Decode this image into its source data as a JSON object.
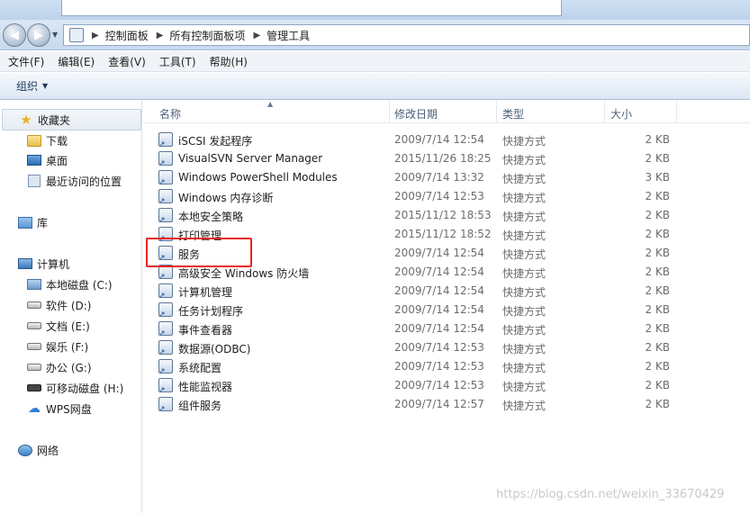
{
  "address": {
    "breadcrumbs": [
      "控制面板",
      "所有控制面板项",
      "管理工具"
    ]
  },
  "menu": [
    "文件(F)",
    "编辑(E)",
    "查看(V)",
    "工具(T)",
    "帮助(H)"
  ],
  "toolbar": {
    "organize": "组织"
  },
  "nav": {
    "favorites": "收藏夹",
    "downloads": "下载",
    "desktop": "桌面",
    "recent": "最近访问的位置",
    "library": "库",
    "computer": "计算机",
    "drive_c": "本地磁盘 (C:)",
    "drive_d": "软件 (D:)",
    "drive_e": "文档 (E:)",
    "drive_f": "娱乐 (F:)",
    "drive_g": "办公 (G:)",
    "drive_h": "可移动磁盘 (H:)",
    "wps": "WPS网盘",
    "network": "网络"
  },
  "columns": {
    "name": "名称",
    "date": "修改日期",
    "type": "类型",
    "size": "大小"
  },
  "files": [
    {
      "name": "iSCSI 发起程序",
      "date": "2009/7/14 12:54",
      "type": "快捷方式",
      "size": "2 KB"
    },
    {
      "name": "VisualSVN Server Manager",
      "date": "2015/11/26 18:25",
      "type": "快捷方式",
      "size": "2 KB"
    },
    {
      "name": "Windows PowerShell Modules",
      "date": "2009/7/14 13:32",
      "type": "快捷方式",
      "size": "3 KB"
    },
    {
      "name": "Windows 内存诊断",
      "date": "2009/7/14 12:53",
      "type": "快捷方式",
      "size": "2 KB"
    },
    {
      "name": "本地安全策略",
      "date": "2015/11/12 18:53",
      "type": "快捷方式",
      "size": "2 KB"
    },
    {
      "name": "打印管理",
      "date": "2015/11/12 18:52",
      "type": "快捷方式",
      "size": "2 KB"
    },
    {
      "name": "服务",
      "date": "2009/7/14 12:54",
      "type": "快捷方式",
      "size": "2 KB"
    },
    {
      "name": "高级安全 Windows 防火墙",
      "date": "2009/7/14 12:54",
      "type": "快捷方式",
      "size": "2 KB"
    },
    {
      "name": "计算机管理",
      "date": "2009/7/14 12:54",
      "type": "快捷方式",
      "size": "2 KB"
    },
    {
      "name": "任务计划程序",
      "date": "2009/7/14 12:54",
      "type": "快捷方式",
      "size": "2 KB"
    },
    {
      "name": "事件查看器",
      "date": "2009/7/14 12:54",
      "type": "快捷方式",
      "size": "2 KB"
    },
    {
      "name": "数据源(ODBC)",
      "date": "2009/7/14 12:53",
      "type": "快捷方式",
      "size": "2 KB"
    },
    {
      "name": "系统配置",
      "date": "2009/7/14 12:53",
      "type": "快捷方式",
      "size": "2 KB"
    },
    {
      "name": "性能监视器",
      "date": "2009/7/14 12:53",
      "type": "快捷方式",
      "size": "2 KB"
    },
    {
      "name": "组件服务",
      "date": "2009/7/14 12:57",
      "type": "快捷方式",
      "size": "2 KB"
    }
  ],
  "watermark": "https://blog.csdn.net/weixin_33670429",
  "colors": {
    "highlight": "#e8231f",
    "toolbar": "#dce7f4"
  }
}
